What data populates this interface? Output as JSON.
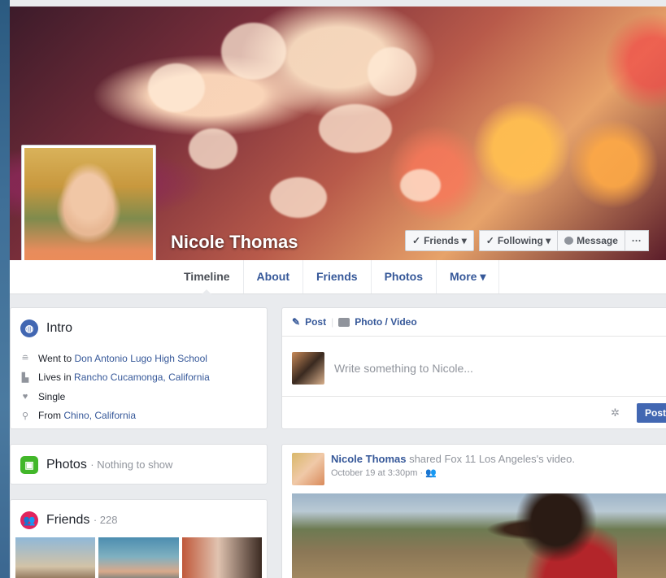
{
  "profile": {
    "name": "Nicole Thomas",
    "buttons": {
      "friends": "Friends ▾",
      "following": "Following ▾",
      "message": "Message",
      "more": "···"
    }
  },
  "tabs": [
    "Timeline",
    "About",
    "Friends",
    "Photos",
    "More ▾"
  ],
  "intro": {
    "title": "Intro",
    "items": [
      {
        "icon": "school-icon",
        "prefix": "Went to ",
        "link": "Don Antonio Lugo High School"
      },
      {
        "icon": "home-icon",
        "prefix": "Lives in ",
        "link": "Rancho Cucamonga, California"
      },
      {
        "icon": "heart-icon",
        "prefix": "Single",
        "link": ""
      },
      {
        "icon": "location-pin-icon",
        "prefix": "From ",
        "link": "Chino, California"
      }
    ]
  },
  "photos": {
    "title": "Photos",
    "note": "· Nothing to show"
  },
  "friends": {
    "title": "Friends",
    "count": "· 228"
  },
  "composer": {
    "post_tab": "Post",
    "photo_tab": "Photo / Video",
    "placeholder": "Write something to Nicole...",
    "post_button": "Post"
  },
  "feed_post": {
    "author": "Nicole Thomas",
    "action": " shared Fox 11 Los Angeles's video.",
    "time": "October 19 at 3:30pm · "
  },
  "colors": {
    "accent": "#4267b2",
    "link": "#365899",
    "background": "#e9ebee"
  }
}
